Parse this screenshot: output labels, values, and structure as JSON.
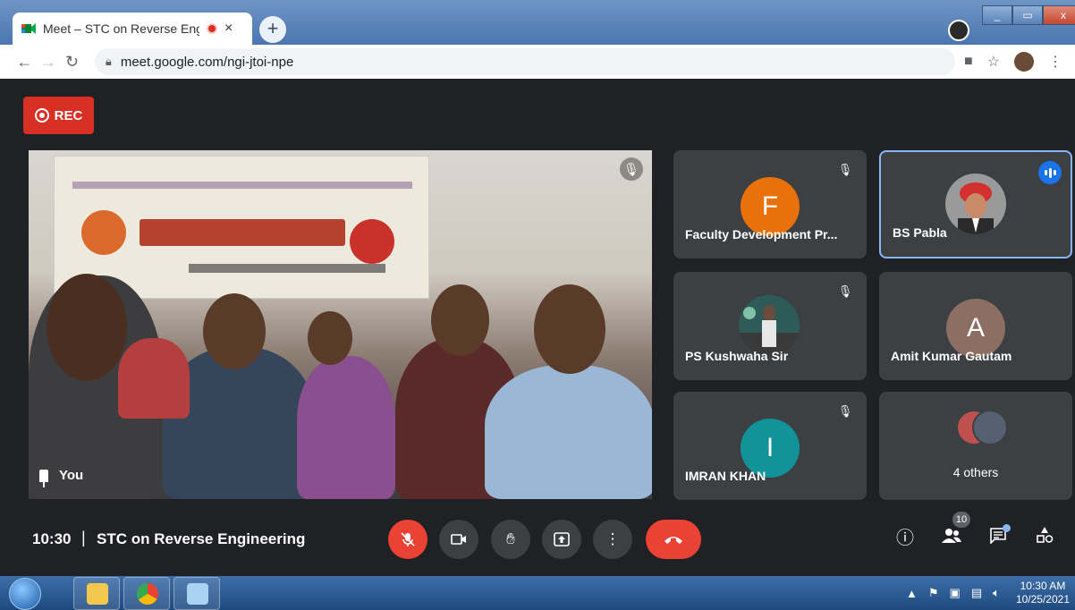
{
  "browser": {
    "tab_title": "Meet – STC on Reverse Engir",
    "tab_close": "×",
    "new_tab": "+",
    "url": "meet.google.com/ngi-jtoi-npe",
    "window_controls": {
      "minimize": "_",
      "maximize": "▭",
      "close": "x"
    }
  },
  "meet": {
    "rec_label": "REC",
    "main_tile": {
      "name": "You"
    },
    "participants": [
      {
        "name": "Faculty Development Pr...",
        "initial": "F",
        "color": "#e8710a",
        "muted": true
      },
      {
        "name": "BS Pabla",
        "speaking": true
      },
      {
        "name": "PS Kushwaha Sir",
        "muted": true
      },
      {
        "name": "Amit Kumar Gautam",
        "initial": "A",
        "color": "#8d6e63"
      },
      {
        "name": "IMRAN KHAN",
        "initial": "I",
        "color": "#12939a",
        "muted": true
      },
      {
        "name": "4 others"
      }
    ],
    "bottom_bar": {
      "time": "10:30",
      "separator": "|",
      "meeting_title": "STC on Reverse Engineering",
      "people_count": "10"
    }
  },
  "taskbar": {
    "clock_time": "10:30 AM",
    "clock_date": "10/25/2021"
  }
}
